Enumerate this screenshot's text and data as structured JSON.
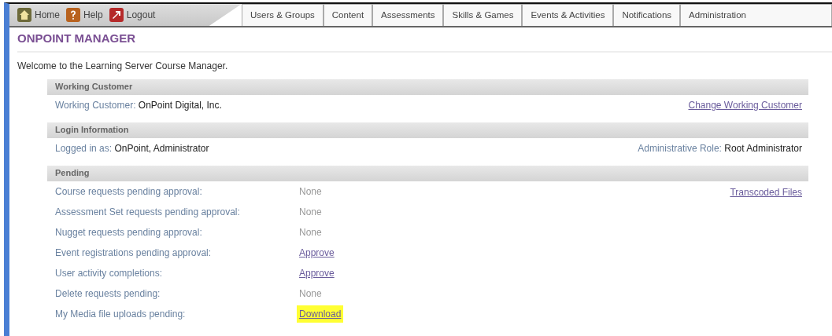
{
  "top_links": [
    {
      "label": "Home",
      "kind": "home"
    },
    {
      "label": "Help",
      "kind": "help"
    },
    {
      "label": "Logout",
      "kind": "logout"
    }
  ],
  "tabs": [
    {
      "label": "Users & Groups",
      "selected": false
    },
    {
      "label": "Content",
      "selected": false
    },
    {
      "label": "Assessments",
      "selected": false
    },
    {
      "label": "Skills & Games",
      "selected": false
    },
    {
      "label": "Events & Activities",
      "selected": false
    },
    {
      "label": "Notifications",
      "selected": false
    },
    {
      "label": "Administration",
      "selected": false
    }
  ],
  "page_title": "ONPOINT MANAGER",
  "welcome": "Welcome to the Learning Server Course Manager.",
  "sections": [
    {
      "heading": "Working Customer",
      "left_label": "Working Customer:",
      "left_value": "OnPoint Digital, Inc.",
      "right_link": "Change Working Customer"
    },
    {
      "heading": "Login Information",
      "left_label": "Logged in as:",
      "left_value": "OnPoint, Administrator",
      "right_label": "Administrative Role:",
      "right_value": "Root Administrator"
    },
    {
      "heading": "Pending",
      "right_link": "Transcoded Files",
      "rows": [
        {
          "label": "Course requests pending approval:",
          "value": "None",
          "kind": "text",
          "highlighted": false
        },
        {
          "label": "Assessment Set requests pending approval:",
          "value": "None",
          "kind": "text",
          "highlighted": false
        },
        {
          "label": "Nugget requests pending approval:",
          "value": "None",
          "kind": "text",
          "highlighted": false
        },
        {
          "label": "Event registrations pending approval:",
          "value": "Approve",
          "kind": "link",
          "highlighted": false
        },
        {
          "label": "User activity completions:",
          "value": "Approve",
          "kind": "link",
          "highlighted": false
        },
        {
          "label": "Delete requests pending:",
          "value": "None",
          "kind": "text",
          "highlighted": false
        },
        {
          "label": "My Media file uploads pending:",
          "value": "Download",
          "kind": "link",
          "highlighted": true
        }
      ]
    }
  ]
}
